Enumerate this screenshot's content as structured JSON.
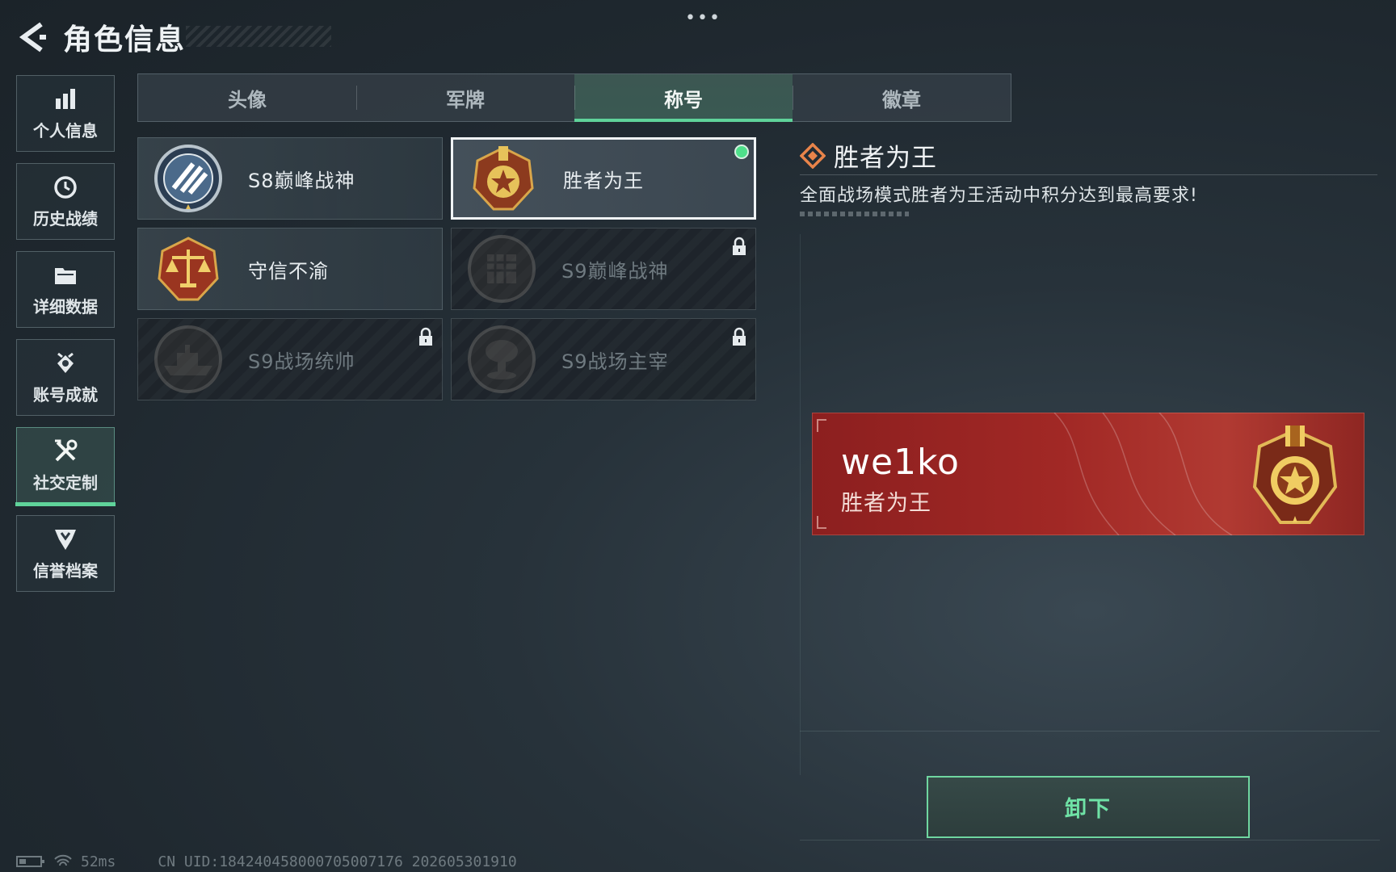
{
  "header": {
    "title": "角色信息",
    "more": "•••"
  },
  "sidebar": {
    "items": [
      {
        "label": "个人信息",
        "icon": "bar-chart-icon"
      },
      {
        "label": "历史战绩",
        "icon": "history-clock-icon"
      },
      {
        "label": "详细数据",
        "icon": "folder-icon"
      },
      {
        "label": "账号成就",
        "icon": "achievement-icon"
      },
      {
        "label": "社交定制",
        "icon": "tools-icon",
        "active": true
      },
      {
        "label": "信誉档案",
        "icon": "credibility-shield-icon"
      }
    ]
  },
  "tabs": [
    {
      "label": "头像"
    },
    {
      "label": "军牌"
    },
    {
      "label": "称号",
      "active": true
    },
    {
      "label": "徽章"
    }
  ],
  "titles": [
    {
      "name": "S8巅峰战神",
      "locked": false,
      "selected": false,
      "icon": "s8-emblem-icon"
    },
    {
      "name": "胜者为王",
      "locked": false,
      "selected": true,
      "equipped": true,
      "icon": "gold-medal-icon"
    },
    {
      "name": "守信不渝",
      "locked": false,
      "selected": false,
      "icon": "scales-emblem-icon"
    },
    {
      "name": "S9巅峰战神",
      "locked": true,
      "selected": false,
      "icon": "building-emblem-icon"
    },
    {
      "name": "S9战场统帅",
      "locked": true,
      "selected": false,
      "icon": "warship-emblem-icon"
    },
    {
      "name": "S9战场主宰",
      "locked": true,
      "selected": false,
      "icon": "mushroom-cloud-emblem-icon"
    }
  ],
  "detail": {
    "name": "胜者为王",
    "description": "全面战场模式胜者为王活动中积分达到最高要求!"
  },
  "preview": {
    "player_name": "we1ko",
    "title": "胜者为王"
  },
  "actions": {
    "unequip_label": "卸下"
  },
  "footer": {
    "ping": "52ms",
    "uid": "CN UID:18424045800070500717​6 202605301910"
  },
  "colors": {
    "accent": "#5fd39a",
    "banner": "#a12825",
    "gold": "#d9b24a"
  }
}
